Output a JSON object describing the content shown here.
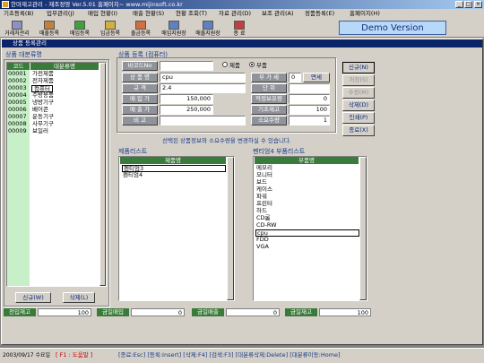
{
  "app": {
    "title": "한마재고관리 - 재조정영 Ver.5.01 홈페이지~ www.mijinsoft.co.kr",
    "minimize": "_",
    "maximize": "□",
    "close": "×"
  },
  "menu": [
    "기초등록(B)",
    "업무관리(J)",
    "매입 현황(I)",
    "매출 현황(S)",
    "현황 조회(T)",
    "자료 관리(D)",
    "보조 관리(A)",
    "정품등록(E)",
    "홈페이지(H)"
  ],
  "toolbar": [
    "거래처관리",
    "매출등록",
    "매입등록",
    "입금등록",
    "출금등록",
    "매입지원장",
    "매출지원장",
    "종 료"
  ],
  "demo": "Demo Version",
  "child": {
    "title": "상품 등록관리"
  },
  "category": {
    "title": "상품 대분류명",
    "col_code": "코드",
    "col_name": "대분류명",
    "rows": [
      {
        "code": "00001",
        "name": "가전제품"
      },
      {
        "code": "00002",
        "name": "전자제품"
      },
      {
        "code": "00003",
        "name": "컴퓨터"
      },
      {
        "code": "00004",
        "name": "주방용품"
      },
      {
        "code": "00005",
        "name": "냉방기구"
      },
      {
        "code": "00006",
        "name": "베어콘"
      },
      {
        "code": "00007",
        "name": "운동기구"
      },
      {
        "code": "00008",
        "name": "사무기구"
      },
      {
        "code": "00009",
        "name": "보일러"
      }
    ],
    "new_btn": "신규(W)",
    "del_btn": "삭제(L)"
  },
  "form": {
    "title": "상품 등록 (컴퓨터)",
    "barcode_label": "바코드No",
    "barcode": "",
    "radio_product": "제품",
    "radio_part": "부품",
    "name_label": "상 품 명",
    "name": "cpu",
    "spec_label": "규  격",
    "spec": "2.4",
    "buy_label": "매 입 가",
    "buy": "150,000",
    "sell_label": "매 출 가",
    "sell": "250,000",
    "note_label": "비  고",
    "note": "",
    "vat_label": "부 가 세",
    "vat": "0",
    "vat_type": "면세",
    "unit_label": "단  위",
    "unit": "",
    "safe_label": "적정보유량",
    "safe": "0",
    "base_label": "기초재고",
    "base": "100",
    "need_label": "소요수량",
    "need": "1"
  },
  "buttons": {
    "new": "신규(N)",
    "save": "저장(S)",
    "edit": "수정(M)",
    "delete": "삭제(D)",
    "print": "인쇄(P)",
    "close": "종료(X)"
  },
  "notice": "선택된 상품정보와 소요수량을 변경하실 수 있습니다.",
  "product_list": {
    "title": "제품리스트",
    "col": "제품명",
    "rows": [
      "펜티엄3",
      "펜티엄4"
    ]
  },
  "parts_list": {
    "title": "펜티엄4 부품리스트",
    "col": "부품명",
    "rows": [
      "메모리",
      "모니터",
      "보드",
      "케이스",
      "파워",
      "프린터",
      "하드",
      "CD롬",
      "CD-RW",
      "cpu",
      "FDD",
      "VGA"
    ]
  },
  "summary": {
    "stock_label": "전입재고",
    "stock": "100",
    "buy_label": "금일매입",
    "buy": "0",
    "sell_label": "금일매출",
    "sell": "0",
    "cur_label": "금일재고",
    "cur": "100"
  },
  "status": {
    "date": "2003/09/17 수요일",
    "f1": "[ F1 : 도움말 ]",
    "shortcuts": "[종료:Esc] [등록:Insert] [삭제:F4] [검색:F3] [대분류삭제:Delete] [대분류이동:Home]"
  },
  "colors": {
    "title": "#0a246a",
    "header_green": "#3a7a3a",
    "code_bg": "#c8f0c8"
  }
}
